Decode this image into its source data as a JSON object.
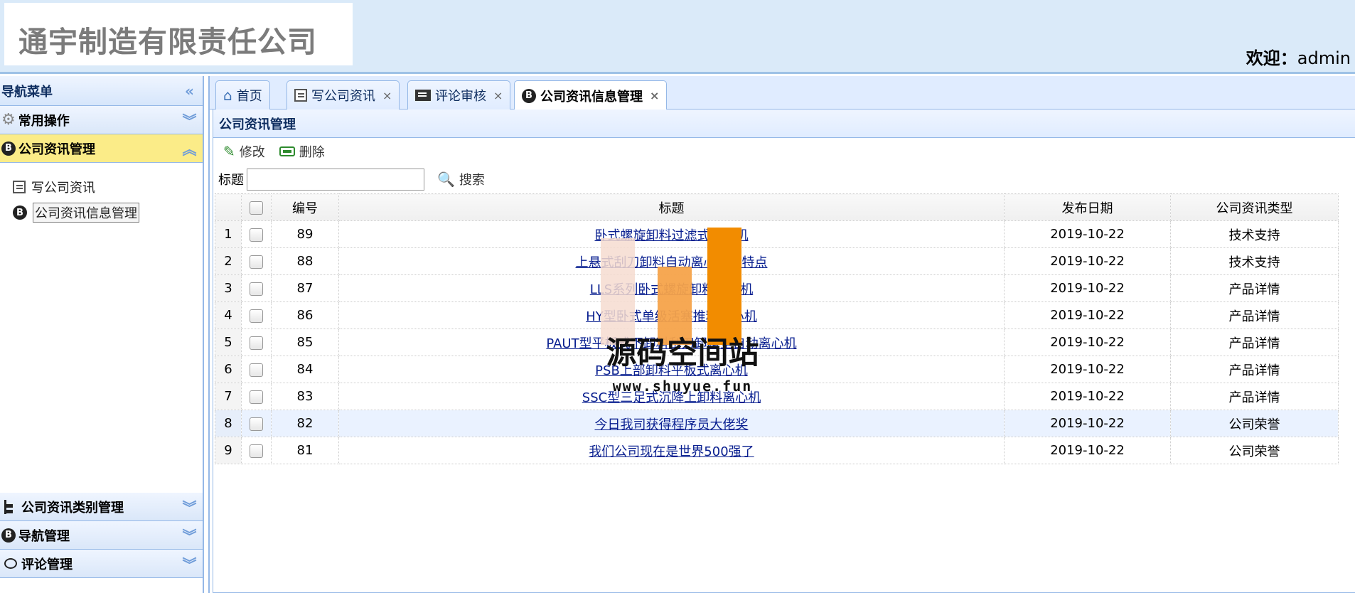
{
  "header": {
    "company_name": "通宇制造有限责任公司",
    "welcome_label": "欢迎：",
    "username": "admin"
  },
  "sidebar": {
    "title": "导航菜单",
    "collapse_icon": "double-chevron-left-icon",
    "sections": [
      {
        "label": "常用操作",
        "icon": "gear-icon",
        "state": "collapsed"
      },
      {
        "label": "公司资讯管理",
        "icon": "b-circle-icon",
        "state": "expanded",
        "items": [
          {
            "label": "写公司资讯",
            "icon": "edit-icon"
          },
          {
            "label": "公司资讯信息管理",
            "icon": "b-circle-icon",
            "selected": true
          }
        ]
      },
      {
        "label": "公司资讯类别管理",
        "icon": "tree-icon",
        "state": "collapsed"
      },
      {
        "label": "导航管理",
        "icon": "b-circle-icon",
        "state": "collapsed"
      },
      {
        "label": "评论管理",
        "icon": "comment-icon",
        "state": "collapsed"
      }
    ]
  },
  "tabs": [
    {
      "label": "首页",
      "icon": "home-icon",
      "closable": false
    },
    {
      "label": "写公司资讯",
      "icon": "edit-icon",
      "closable": true
    },
    {
      "label": "评论审核",
      "icon": "review-icon",
      "closable": true
    },
    {
      "label": "公司资讯信息管理",
      "icon": "b-circle-icon",
      "closable": true,
      "active": true
    }
  ],
  "close_glyph": "×",
  "panel": {
    "title": "公司资讯管理",
    "toolbar": {
      "edit_label": "修改",
      "delete_label": "删除"
    },
    "search": {
      "field_label": "标题",
      "value": "",
      "placeholder": "",
      "button_label": "搜索"
    },
    "columns": [
      "编号",
      "标题",
      "发布日期",
      "公司资讯类型"
    ],
    "rows": [
      {
        "rn": "1",
        "id": "89",
        "title": "卧式螺旋卸料过滤式离心机",
        "date": "2019-10-22",
        "type": "技术支持"
      },
      {
        "rn": "2",
        "id": "88",
        "title": "上悬式刮刀卸料自动离心机的特点",
        "date": "2019-10-22",
        "type": "技术支持"
      },
      {
        "rn": "3",
        "id": "87",
        "title": "LLS系列卧式螺旋卸料离心机",
        "date": "2019-10-22",
        "type": "产品详情"
      },
      {
        "rn": "4",
        "id": "86",
        "title": "HY型卧式单级活塞推料离心机",
        "date": "2019-10-22",
        "type": "产品详情"
      },
      {
        "rn": "5",
        "id": "85",
        "title": "PAUT型平板式下卸料刮刀卸料全自动离心机",
        "date": "2019-10-22",
        "type": "产品详情"
      },
      {
        "rn": "6",
        "id": "84",
        "title": "PSB上部卸料平板式离心机",
        "date": "2019-10-22",
        "type": "产品详情"
      },
      {
        "rn": "7",
        "id": "83",
        "title": "SSC型三足式沉降上卸料离心机",
        "date": "2019-10-22",
        "type": "产品详情"
      },
      {
        "rn": "8",
        "id": "82",
        "title": "今日我司获得程序员大佬奖",
        "date": "2019-10-22",
        "type": "公司荣誉",
        "highlight": true
      },
      {
        "rn": "9",
        "id": "81",
        "title": "我们公司现在是世界500强了",
        "date": "2019-10-22",
        "type": "公司荣誉"
      }
    ]
  },
  "watermark": {
    "text": "源码空间站",
    "url": "www.shuyue.fun"
  },
  "colors": {
    "header_bg": "#daeaf9",
    "border": "#95b8e7",
    "active_section": "#fbec88",
    "link": "#0a2090",
    "watermark_orange": "#f28c00"
  }
}
